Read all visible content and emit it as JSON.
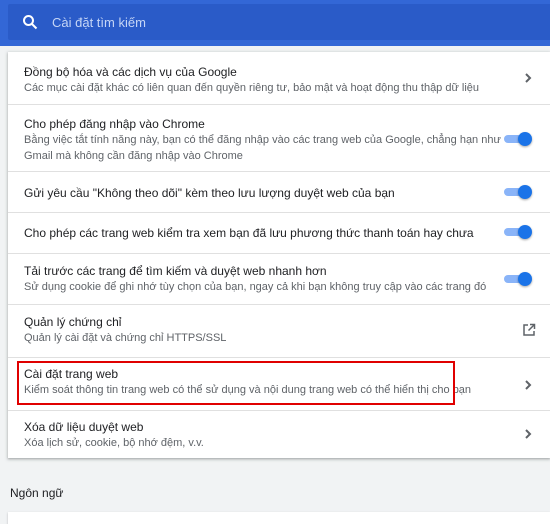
{
  "search": {
    "placeholder": "Cài đặt tìm kiếm",
    "icon": "search-icon"
  },
  "accent": "#1a73e8",
  "rows": [
    {
      "title": "Đồng bộ hóa và các dịch vụ của Google",
      "desc": [
        "Các mục cài đặt khác có liên quan đến quyền riêng tư, bảo mật và hoạt động thu thập dữ liệu"
      ],
      "control": "chevron"
    },
    {
      "title": "Cho phép đăng nhập vào Chrome",
      "desc": [
        "Bằng việc tắt tính năng này, bạn có thể đăng nhập vào các trang web của Google, chẳng hạn như",
        "Gmail mà không cần đăng nhập vào Chrome"
      ],
      "control": "toggle",
      "enabled": true
    },
    {
      "title": "Gửi yêu cầu \"Không theo dõi\" kèm theo lưu lượng duyệt web của bạn",
      "desc": [],
      "control": "toggle",
      "enabled": true
    },
    {
      "title": "Cho phép các trang web kiểm tra xem bạn đã lưu phương thức thanh toán hay chưa",
      "desc": [],
      "control": "toggle",
      "enabled": true
    },
    {
      "title": "Tải trước các trang để tìm kiếm và duyệt web nhanh hơn",
      "desc": [
        "Sử dụng cookie để ghi nhớ tùy chọn của bạn, ngay cả khi bạn không truy cập vào các trang đó"
      ],
      "control": "toggle",
      "enabled": true
    },
    {
      "title": "Quản lý chứng chỉ",
      "desc": [
        "Quản lý cài đặt và chứng chỉ HTTPS/SSL"
      ],
      "control": "external-link"
    },
    {
      "title": "Cài đặt trang web",
      "desc": [
        "Kiểm soát thông tin trang web có thể sử dụng và nội dung trang web có thể hiển thị cho bạn"
      ],
      "control": "chevron",
      "highlighted": true
    },
    {
      "title": "Xóa dữ liệu duyệt web",
      "desc": [
        "Xóa lịch sử, cookie, bộ nhớ đệm, v.v."
      ],
      "control": "chevron"
    }
  ],
  "section_language": "Ngôn ngữ"
}
